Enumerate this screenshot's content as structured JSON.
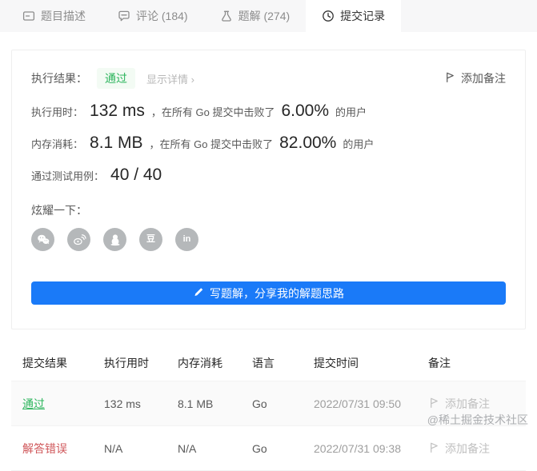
{
  "tabs": [
    {
      "label": "题目描述",
      "icon": "description-icon",
      "active": false
    },
    {
      "label": "评论 (184)",
      "icon": "comment-icon",
      "active": false
    },
    {
      "label": "题解 (274)",
      "icon": "flask-icon",
      "active": false
    },
    {
      "label": "提交记录",
      "icon": "clock-icon",
      "active": true
    }
  ],
  "result_panel": {
    "result_label": "执行结果：",
    "result_value": "通过",
    "show_details": "显示详情 ›",
    "add_note_label": "添加备注",
    "runtime_label": "执行用时：",
    "runtime_value": "132 ms",
    "runtime_beats_prefix": "，在所有 Go 提交中击败了",
    "runtime_beats_value": "6.00%",
    "runtime_beats_suffix": "的用户",
    "memory_label": "内存消耗：",
    "memory_value": "8.1 MB",
    "memory_beats_prefix": "，在所有 Go 提交中击败了",
    "memory_beats_value": "82.00%",
    "memory_beats_suffix": "的用户",
    "testcases_label": "通过测试用例：",
    "testcases_value": "40 / 40",
    "share_label": "炫耀一下：",
    "social_icons": [
      "wechat-icon",
      "weibo-icon",
      "qq-icon",
      "douban-icon",
      "linkedin-icon"
    ],
    "douban_glyph": "豆",
    "linkedin_glyph": "in",
    "write_solution_button": "写题解，分享我的解题思路"
  },
  "table": {
    "headers": [
      "提交结果",
      "执行用时",
      "内存消耗",
      "语言",
      "提交时间",
      "备注"
    ],
    "rows": [
      {
        "result": "通过",
        "status": "accepted",
        "runtime": "132 ms",
        "memory": "8.1 MB",
        "language": "Go",
        "time": "2022/07/31 09:50",
        "note": "添加备注"
      },
      {
        "result": "解答错误",
        "status": "wrong",
        "runtime": "N/A",
        "memory": "N/A",
        "language": "Go",
        "time": "2022/07/31 09:38",
        "note": "添加备注"
      }
    ]
  },
  "watermark": "@稀土掘金技术社区",
  "colors": {
    "accent_blue": "#1a7af8",
    "success_green": "#2db55d",
    "error_red": "#cf5659",
    "tabbar_bg": "#f7f7f8"
  }
}
